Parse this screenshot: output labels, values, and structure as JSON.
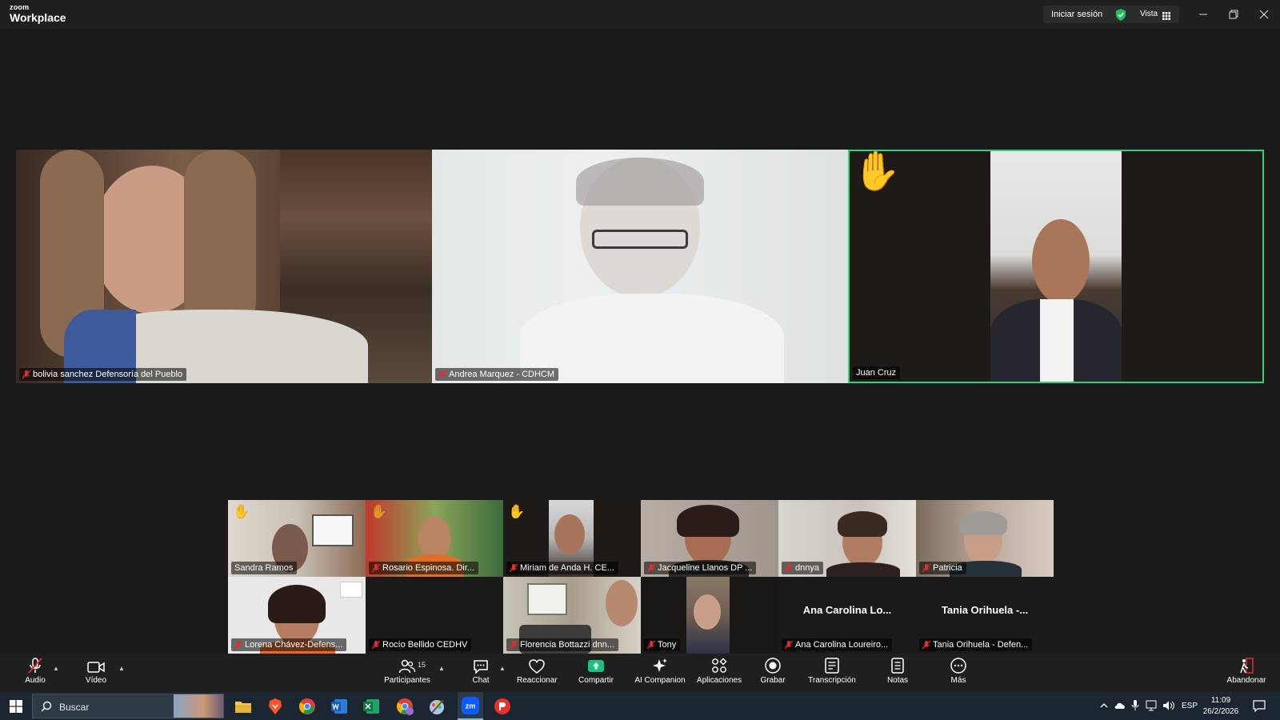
{
  "app": {
    "brand_small": "zoom",
    "brand_large": "Workplace",
    "signin_label": "Iniciar sesión",
    "view_label": "Vista"
  },
  "speakers": [
    {
      "name": "bolivia sanchez Defensoría del Pueblo",
      "muted": true,
      "hand_raised": false
    },
    {
      "name": "Andrea Marquez - CDHCM",
      "muted": true,
      "hand_raised": false
    },
    {
      "name": "Juan Cruz",
      "muted": false,
      "hand_raised": true,
      "active_speaker": true
    }
  ],
  "gallery": [
    {
      "name": "Sandra Ramos",
      "muted": false,
      "hand_raised": true
    },
    {
      "name": "Rosario Espinosa. Dir...",
      "muted": true,
      "hand_raised": true
    },
    {
      "name": "Miriam de Anda H. CE...",
      "muted": true,
      "hand_raised": true
    },
    {
      "name": "Jacqueline  Llanos DP ...",
      "muted": true,
      "hand_raised": false
    },
    {
      "name": "dnnya",
      "muted": true,
      "hand_raised": false
    },
    {
      "name": "Patricia",
      "muted": true,
      "hand_raised": false
    },
    {
      "name": "Lorena Chávez-Defens...",
      "muted": true,
      "hand_raised": false
    },
    {
      "name": "Rocío Bellido CEDHV",
      "muted": true,
      "hand_raised": false
    },
    {
      "name": "Florencia Bottazzi dnn...",
      "muted": true,
      "hand_raised": false
    },
    {
      "name": "Tony",
      "muted": true,
      "hand_raised": false
    },
    {
      "name": "Ana Carolina Loureiro...",
      "display_name": "Ana Carolina Lo...",
      "muted": true,
      "hand_raised": false
    },
    {
      "name": "Tania Orihuela - Defen...",
      "display_name": "Tania Orihuela -...",
      "muted": true,
      "hand_raised": false
    }
  ],
  "toolbar": {
    "audio": "Audio",
    "video": "Vídeo",
    "participants": "Participantes",
    "participants_count": "15",
    "chat": "Chat",
    "react": "Reaccionar",
    "share": "Compartir",
    "ai": "AI Companion",
    "apps": "Aplicaciones",
    "record": "Grabar",
    "transcript": "Transcripción",
    "notes": "Notas",
    "more": "Más",
    "leave": "Abandonar"
  },
  "taskbar": {
    "search_placeholder": "Buscar",
    "language": "ESP",
    "time": "11:09",
    "date": "26/2/2026"
  },
  "colors": {
    "active_speaker_border": "#2ed573",
    "share_green": "#19c37d",
    "muted_red": "#e02f2f"
  }
}
